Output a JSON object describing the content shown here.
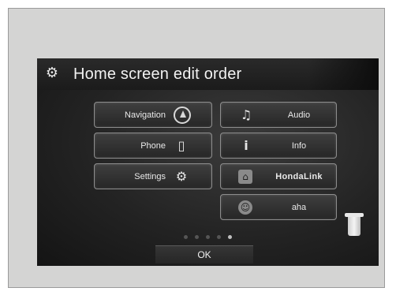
{
  "screen": {
    "title": "Home screen edit order",
    "title_icon": "gear-icon"
  },
  "tiles_left": [
    {
      "label": "Navigation",
      "icon": "navigation-compass-icon"
    },
    {
      "label": "Phone",
      "icon": "phone-icon"
    },
    {
      "label": "Settings",
      "icon": "gear-icon"
    }
  ],
  "tiles_right": [
    {
      "label": "Audio",
      "icon": "music-note-icon"
    },
    {
      "label": "Info",
      "icon": "info-icon"
    },
    {
      "label": "HondaLink",
      "icon": "hondalink-icon"
    },
    {
      "label": "aha",
      "icon": "aha-icon"
    }
  ],
  "page_indicator": {
    "count": 5,
    "active_index": 4
  },
  "ok_button": {
    "label": "OK"
  },
  "trash": {
    "icon": "trash-can-icon"
  }
}
